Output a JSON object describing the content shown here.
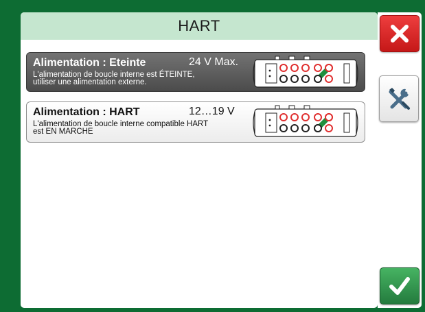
{
  "title": "HART",
  "rows": [
    {
      "title": "Alimentation : Eteinte",
      "voltage": "24 V Max.",
      "desc_line1": "L'alimentation de boucle interne est ÉTEINTE,",
      "desc_line2": "utiliser une alimentation externe.",
      "state": "selected"
    },
    {
      "title": "Alimentation : HART",
      "voltage": "12…19 V",
      "desc_line1": "L'alimentation de boucle interne compatible HART",
      "desc_line2": "est EN MARCHE",
      "state": "normal"
    }
  ],
  "side_buttons": {
    "close_icon": "close-x-icon",
    "tools_icon": "wrench-screwdriver-icon",
    "ok_icon": "checkmark-icon"
  },
  "colors": {
    "frame": "#0d6c33",
    "title_bar": "#c5e6cf",
    "close": "#d42424",
    "ok": "#2f8f4a",
    "terminal_red": "#e03030",
    "terminal_black": "#222222",
    "wire_green": "#1e8f3c"
  }
}
